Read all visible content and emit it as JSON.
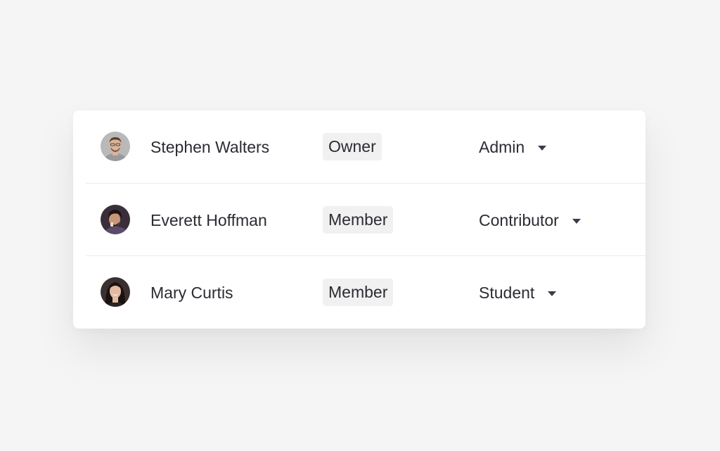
{
  "members": [
    {
      "name": "Stephen Walters",
      "membership": "Owner",
      "role": "Admin",
      "avatar_icon": "avatar-photo-stephen",
      "avatar_colors": {
        "bg": "#b9b9b9",
        "skin": "#d9b49a",
        "hair": "#5a3f2e",
        "shirt": "#9a9a9a"
      }
    },
    {
      "name": "Everett Hoffman",
      "membership": "Member",
      "role": "Contributor",
      "avatar_icon": "avatar-photo-everett",
      "avatar_colors": {
        "bg": "#3a2e3a",
        "skin": "#c99677",
        "hair": "#1d1512",
        "shirt": "#5b4c6e"
      }
    },
    {
      "name": "Mary Curtis",
      "membership": "Member",
      "role": "Student",
      "avatar_icon": "avatar-photo-mary",
      "avatar_colors": {
        "bg": "#3b3030",
        "skin": "#e2bba2",
        "hair": "#1a1210",
        "shirt": "#2b2222"
      }
    }
  ]
}
